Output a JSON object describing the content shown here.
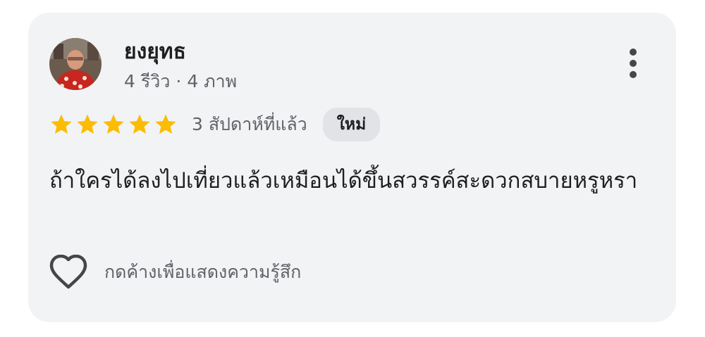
{
  "review": {
    "author": {
      "name": "ยงยุทธ",
      "reviews_count": "4 รีวิว",
      "separator": "·",
      "photos_count": "4 ภาพ",
      "avatar_icon": "user-avatar-photo"
    },
    "rating": {
      "stars": 5,
      "max": 5,
      "star_color": "#fbbc04"
    },
    "time_ago": "3 สัปดาห์ที่แล้ว",
    "badge": "ใหม่",
    "text": "ถ้าใครได้ลงไปเที่ยวแล้วเหมือนได้ขึ้นสวรรค์สะดวกสบายหรูหรา",
    "like_label": "กดค้างเพื่อแสดงความรู้สึก",
    "icons": {
      "more": "more-vert-icon",
      "like": "heart-outline-icon"
    }
  }
}
